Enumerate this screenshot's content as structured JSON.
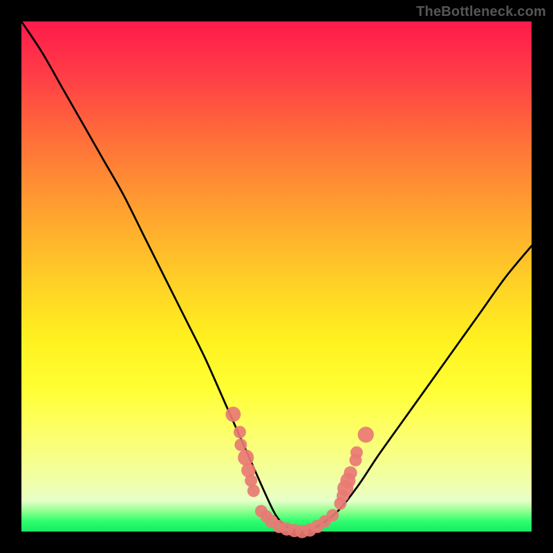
{
  "watermark": "TheBottleneck.com",
  "colors": {
    "frame": "#000000",
    "curve": "#000000",
    "dots": "#e87a74",
    "gradient_top": "#ff1a4b",
    "gradient_bottom": "#18e864"
  },
  "chart_data": {
    "type": "line",
    "title": "",
    "xlabel": "",
    "ylabel": "",
    "xlim": [
      0,
      100
    ],
    "ylim": [
      0,
      100
    ],
    "grid": false,
    "series": [
      {
        "name": "bottleneck-curve",
        "x": [
          0,
          4,
          8,
          12,
          16,
          20,
          24,
          28,
          32,
          36,
          40,
          44,
          48,
          50,
          52,
          55,
          58,
          62,
          66,
          70,
          75,
          80,
          85,
          90,
          95,
          100
        ],
        "values": [
          100,
          94,
          87,
          80,
          73,
          66,
          58,
          50,
          42,
          34,
          25,
          16,
          7,
          3,
          1,
          0,
          1,
          4,
          9,
          15,
          22,
          29,
          36,
          43,
          50,
          56
        ]
      }
    ],
    "scatter": [
      {
        "name": "left-cluster",
        "points": [
          {
            "x": 41.5,
            "y": 23.0,
            "r": 1.2
          },
          {
            "x": 42.8,
            "y": 19.5,
            "r": 0.9
          },
          {
            "x": 43.0,
            "y": 17.0,
            "r": 0.9
          },
          {
            "x": 44.0,
            "y": 14.5,
            "r": 1.3
          },
          {
            "x": 44.5,
            "y": 12.0,
            "r": 1.1
          },
          {
            "x": 45.0,
            "y": 10.0,
            "r": 0.9
          },
          {
            "x": 45.5,
            "y": 8.0,
            "r": 0.9
          }
        ]
      },
      {
        "name": "bottom-cluster",
        "points": [
          {
            "x": 47.0,
            "y": 4.0,
            "r": 0.9
          },
          {
            "x": 48.0,
            "y": 3.0,
            "r": 0.9
          },
          {
            "x": 49.0,
            "y": 2.0,
            "r": 1.0
          },
          {
            "x": 50.5,
            "y": 1.0,
            "r": 1.0
          },
          {
            "x": 52.0,
            "y": 0.5,
            "r": 1.0
          },
          {
            "x": 53.5,
            "y": 0.2,
            "r": 1.0
          },
          {
            "x": 55.0,
            "y": 0.0,
            "r": 1.0
          },
          {
            "x": 56.5,
            "y": 0.3,
            "r": 1.0
          },
          {
            "x": 58.0,
            "y": 1.0,
            "r": 1.0
          },
          {
            "x": 59.5,
            "y": 2.0,
            "r": 0.9
          },
          {
            "x": 61.0,
            "y": 3.2,
            "r": 0.9
          }
        ]
      },
      {
        "name": "right-cluster",
        "points": [
          {
            "x": 62.5,
            "y": 5.5,
            "r": 0.9
          },
          {
            "x": 63.0,
            "y": 7.0,
            "r": 0.9
          },
          {
            "x": 63.5,
            "y": 8.5,
            "r": 1.3
          },
          {
            "x": 64.0,
            "y": 10.0,
            "r": 1.2
          },
          {
            "x": 64.5,
            "y": 11.5,
            "r": 1.0
          },
          {
            "x": 65.5,
            "y": 14.0,
            "r": 0.9
          },
          {
            "x": 65.7,
            "y": 15.5,
            "r": 0.9
          },
          {
            "x": 67.5,
            "y": 19.0,
            "r": 1.3
          }
        ]
      }
    ]
  }
}
